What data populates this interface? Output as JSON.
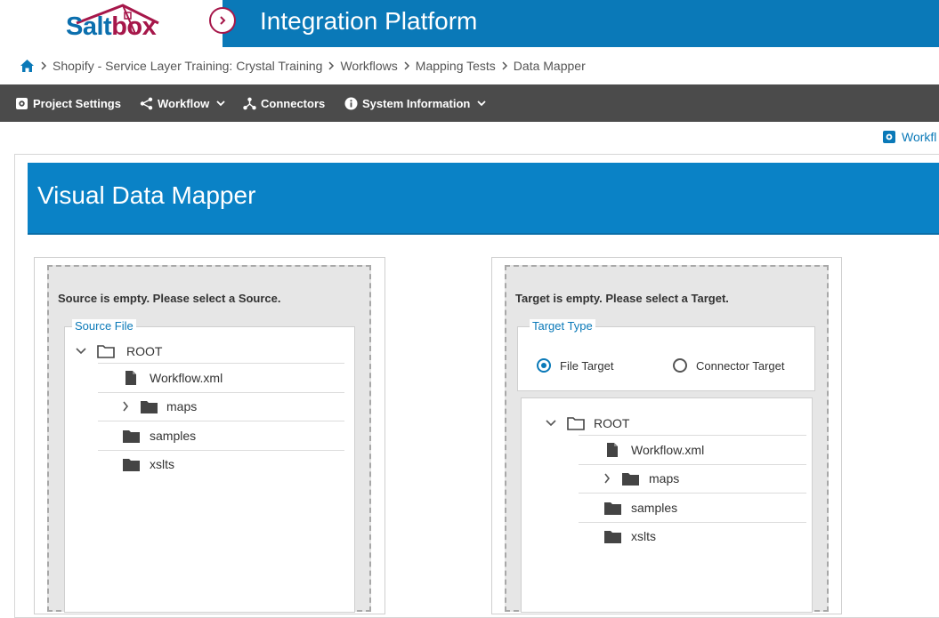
{
  "header": {
    "logo_text_a": "Salt",
    "logo_text_b": "box",
    "app_title": "Integration Platform"
  },
  "breadcrumb": {
    "items": [
      "Shopify - Service Layer Training: Crystal Training",
      "Workflows",
      "Mapping Tests",
      "Data Mapper"
    ]
  },
  "toolbar": {
    "project_settings": "Project Settings",
    "workflow": "Workflow",
    "connectors": "Connectors",
    "system_information": "System Information"
  },
  "top_link": "Workfl",
  "mapper": {
    "title": "Visual Data Mapper"
  },
  "source": {
    "empty_message": "Source is empty. Please select a Source.",
    "legend": "Source File",
    "root": "ROOT",
    "items": [
      "Workflow.xml",
      "maps",
      "samples",
      "xslts"
    ]
  },
  "target": {
    "empty_message": "Target is empty. Please select a Target.",
    "legend": "Target Type",
    "radio_file": "File Target",
    "radio_connector": "Connector Target",
    "selected": "File Target",
    "root": "ROOT",
    "items": [
      "Workflow.xml",
      "maps",
      "samples",
      "xslts"
    ]
  },
  "colors": {
    "brand_blue": "#0a79b8",
    "brand_red": "#a6174a",
    "toolbar_bg": "#4b4b4b"
  }
}
